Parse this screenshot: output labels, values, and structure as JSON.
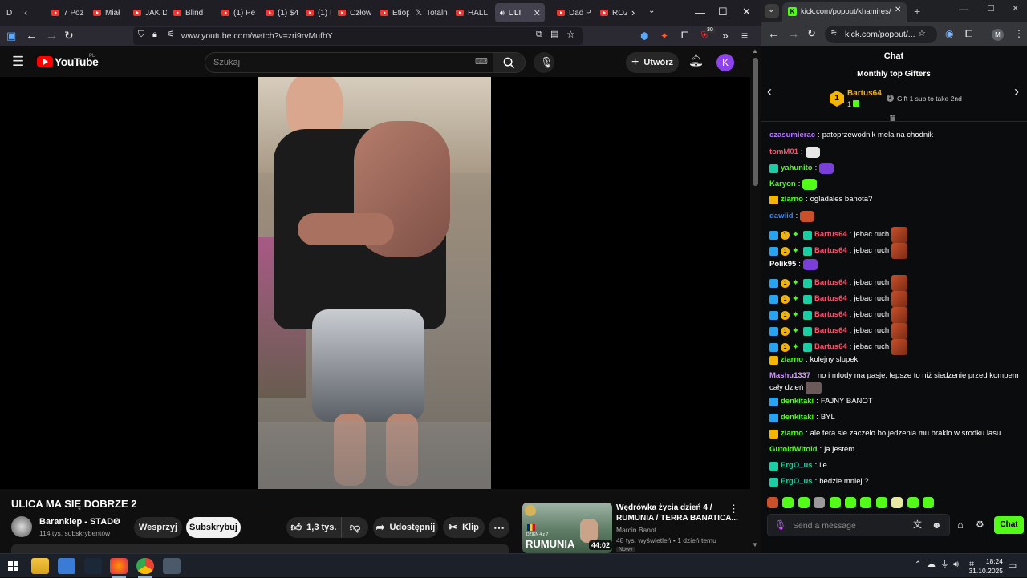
{
  "browser_left": {
    "tabs": [
      {
        "label": "D"
      },
      {
        "label": "7 Poz"
      },
      {
        "label": "Miał"
      },
      {
        "label": "JAK D"
      },
      {
        "label": "Blind"
      },
      {
        "label": "(1) Pe"
      },
      {
        "label": "(1) $4"
      },
      {
        "label": "(1) Dl"
      },
      {
        "label": "Człow"
      },
      {
        "label": "Etiop"
      },
      {
        "label": "Totaln"
      },
      {
        "label": "HALL"
      },
      {
        "label": "ULI"
      },
      {
        "label": "Dad P"
      },
      {
        "label": "ROZM"
      }
    ],
    "url": "www.youtube.com/watch?v=zri9rvMufhY",
    "ext_badge": "30"
  },
  "youtube": {
    "logo": "YouTube",
    "logo_region": "PL",
    "search_placeholder": "Szukaj",
    "create_label": "Utwórz",
    "avatar_letter": "K",
    "video_title": "ULICA MA SIĘ DOBRZE 2",
    "channel_name": "Barankiep - STADO",
    "subscribers": "114 tys. subskrybentów",
    "support_label": "Wesprzyj",
    "subscribe_label": "Subskrybuj",
    "likes": "1,3 tys.",
    "share_label": "Udostępnij",
    "clip_label": "Klip",
    "related": {
      "title_line1": "Wędrówka życia dzień 4 /",
      "title_line2": "RUMUNIA / TERRA BANATICA...",
      "channel": "Marcin Banot",
      "meta": "48 tys. wyświetleń • 1 dzień temu",
      "badge": "Nowy",
      "thumb_text": "RUMUNIA",
      "thumb_small": "DZIEŃ 4 z 7",
      "duration": "44:02"
    }
  },
  "browser_right": {
    "url": "kick.com/popout/...",
    "tab_title": "kick.com/popout/khamires/cha",
    "profile_letter": "M"
  },
  "chat": {
    "header": "Chat",
    "gifters_title": "Monthly top Gifters",
    "top_gifter": {
      "name": "Bartus64",
      "count": "1",
      "rank": "1"
    },
    "gift_hint": "Gift 1 sub to take 2nd",
    "messages": [
      {
        "user": "czasumierac",
        "color": "#b57bff",
        "text": "patoprzewodnik mela na chodnik",
        "badges": [],
        "emote": false
      },
      {
        "user": "tomM01",
        "color": "#ff4d6d",
        "text": "",
        "badges": [],
        "emote": true
      },
      {
        "user": "yahunito",
        "color": "#53fc18",
        "text": "",
        "badges": [
          "mod"
        ],
        "emote": true
      },
      {
        "user": "Karyon",
        "color": "#53fc18",
        "text": "",
        "badges": [],
        "emote": true
      },
      {
        "user": "ziarno",
        "color": "#53fc18",
        "text": "ogladales banota?",
        "badges": [
          "crown"
        ],
        "emote": false
      },
      {
        "user": "dawiid",
        "color": "#2e86ff",
        "text": "",
        "badges": [],
        "emote": true
      },
      {
        "user": "Bartus64",
        "color": "#ff4d6d",
        "text": "jebac ruch",
        "badges": [
          "vip",
          "sub",
          "green",
          "gift"
        ],
        "emote": true
      },
      {
        "user": "Bartus64",
        "color": "#ff4d6d",
        "text": "jebac ruch",
        "badges": [
          "vip",
          "sub",
          "green",
          "gift"
        ],
        "emote": true
      },
      {
        "user": "Polik95",
        "color": "#ffffff",
        "text": "",
        "badges": [],
        "emote": true
      },
      {
        "user": "Bartus64",
        "color": "#ff4d6d",
        "text": "jebac ruch",
        "badges": [
          "vip",
          "sub",
          "green",
          "gift"
        ],
        "emote": true
      },
      {
        "user": "Bartus64",
        "color": "#ff4d6d",
        "text": "jebac ruch",
        "badges": [
          "vip",
          "sub",
          "green",
          "gift"
        ],
        "emote": true
      },
      {
        "user": "Bartus64",
        "color": "#ff4d6d",
        "text": "jebac ruch",
        "badges": [
          "vip",
          "sub",
          "green",
          "gift"
        ],
        "emote": true
      },
      {
        "user": "Bartus64",
        "color": "#ff4d6d",
        "text": "jebac ruch",
        "badges": [
          "vip",
          "sub",
          "green",
          "gift"
        ],
        "emote": true
      },
      {
        "user": "Bartus64",
        "color": "#ff4d6d",
        "text": "jebac ruch",
        "badges": [
          "vip",
          "sub",
          "green",
          "gift"
        ],
        "emote": true
      },
      {
        "user": "ziarno",
        "color": "#53fc18",
        "text": "kolejny slupek",
        "badges": [
          "crown"
        ],
        "emote": false
      },
      {
        "user": "Mashu1337",
        "color": "#d59bff",
        "text": "no i mlody ma pasje, lepsze to niż siedzenie przed kompem",
        "text2": "cały dzień",
        "badges": [],
        "emote": true
      },
      {
        "user": "denkitaki",
        "color": "#53fc18",
        "text": "FAJNY BANOT",
        "badges": [
          "vip"
        ],
        "emote": false
      },
      {
        "user": "denkitaki",
        "color": "#53fc18",
        "text": "BYL",
        "badges": [
          "vip"
        ],
        "emote": false
      },
      {
        "user": "ziarno",
        "color": "#53fc18",
        "text": "ale tera sie zaczelo bo jedzenia mu braklo w srodku lasu",
        "badges": [
          "crown"
        ],
        "emote": false
      },
      {
        "user": "GutoldWitold",
        "color": "#53fc18",
        "text": "ja jestem",
        "badges": [],
        "emote": false
      },
      {
        "user": "ErgO_us",
        "color": "#18cfa3",
        "text": "ile",
        "badges": [
          "mod"
        ],
        "emote": false
      },
      {
        "user": "ErgO_us",
        "color": "#18cfa3",
        "text": "bedzie mniej ?",
        "badges": [
          "mod"
        ],
        "emote": false
      }
    ],
    "input_placeholder": "Send a message",
    "send_label": "Chat"
  },
  "taskbar": {
    "time": "18:24",
    "date": "31.10.2025"
  },
  "colors": {
    "kick_green": "#53fc18",
    "yt_red": "#ff0000",
    "avatar": "#8e44ec"
  }
}
